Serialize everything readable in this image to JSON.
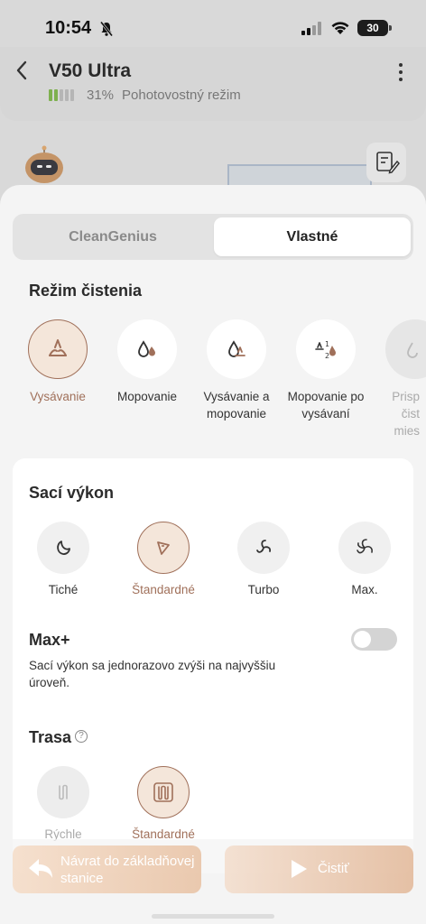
{
  "status_bar": {
    "time": "10:54",
    "battery": "30"
  },
  "header": {
    "title": "V50 Ultra",
    "battery_percent": "31%",
    "state": "Pohotovostný režim",
    "battery_level": 0.31
  },
  "tabs": [
    {
      "label": "CleanGenius",
      "selected": false
    },
    {
      "label": "Vlastné",
      "selected": true
    }
  ],
  "cleaning_mode": {
    "title": "Režim čistenia",
    "modes": [
      {
        "label": "Vysávanie",
        "icon": "vacuum-icon",
        "selected": true
      },
      {
        "label": "Mopovanie",
        "icon": "mop-drops-icon",
        "selected": false
      },
      {
        "label": "Vysávanie a\nmopovanie",
        "icon": "vacuum-mop-icon",
        "selected": false
      },
      {
        "label": "Mopovanie po\nvysávaní",
        "icon": "mop-after-vacuum-icon",
        "selected": false
      },
      {
        "label": "Prisp\nčist\nmies",
        "icon": "custom-room-icon",
        "selected": false
      }
    ]
  },
  "suction": {
    "title": "Sací výkon",
    "levels": [
      {
        "label": "Tiché",
        "icon": "quiet-fan-icon",
        "selected": false
      },
      {
        "label": "Štandardné",
        "icon": "standard-fan-icon",
        "selected": true
      },
      {
        "label": "Turbo",
        "icon": "turbo-fan-icon",
        "selected": false
      },
      {
        "label": "Max.",
        "icon": "max-fan-icon",
        "selected": false
      }
    ]
  },
  "max_plus": {
    "title": "Max+",
    "description": "Sací výkon sa jednorazovo zvýši na najvyššiu úroveň.",
    "enabled": false
  },
  "route": {
    "title": "Trasa",
    "help": "?",
    "options": [
      {
        "label": "Rýchle",
        "icon": "quick-route-icon",
        "selected": false
      },
      {
        "label": "Štandardné",
        "icon": "standard-route-icon",
        "selected": true
      }
    ]
  },
  "actions": {
    "return_label": "Návrat do základňovej stanice",
    "clean_label": "Čistiť"
  },
  "colors": {
    "accent": "#a0705a",
    "accent_bg": "#f4e6da",
    "battery_green": "#7eb04f"
  }
}
